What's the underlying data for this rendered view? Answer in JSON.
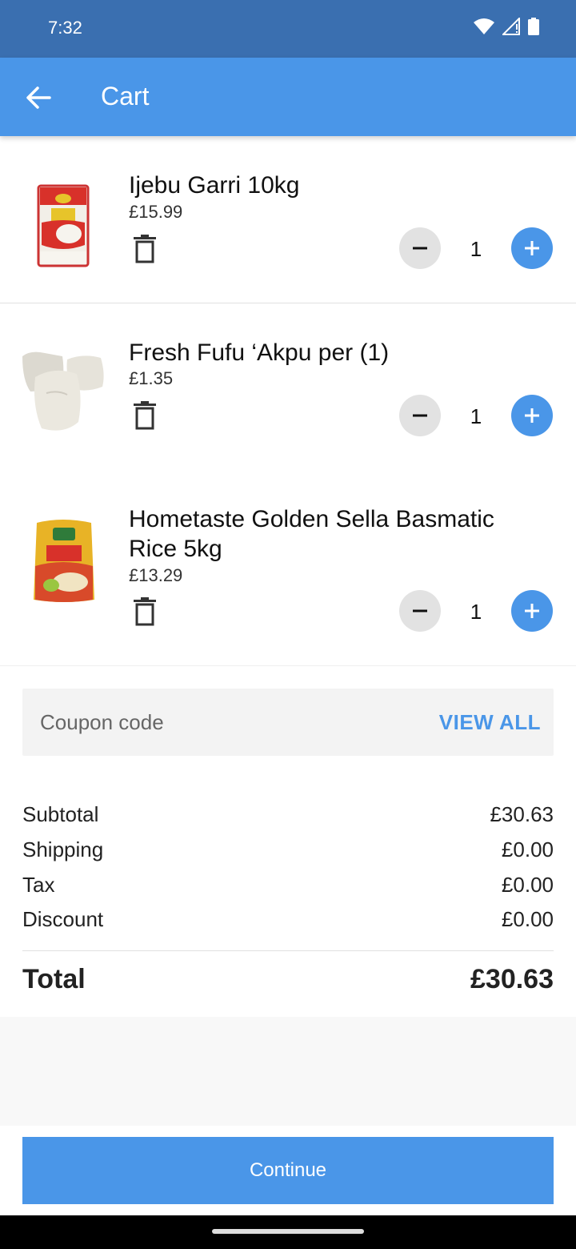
{
  "status": {
    "time": "7:32"
  },
  "header": {
    "title": "Cart"
  },
  "items": [
    {
      "name": "Ijebu Garri 10kg",
      "price": "£15.99",
      "qty": "1"
    },
    {
      "name": "Fresh Fufu ‘Akpu per (1)",
      "price": "£1.35",
      "qty": "1"
    },
    {
      "name": "Hometaste Golden Sella Basmatic Rice 5kg",
      "price": "£13.29",
      "qty": "1"
    }
  ],
  "coupon": {
    "placeholder": "Coupon code",
    "view_all_label": "VIEW ALL"
  },
  "summary": {
    "subtotal_label": "Subtotal",
    "subtotal_value": "£30.63",
    "shipping_label": "Shipping",
    "shipping_value": "£0.00",
    "tax_label": "Tax",
    "tax_value": "£0.00",
    "discount_label": "Discount",
    "discount_value": "£0.00",
    "total_label": "Total",
    "total_value": "£30.63"
  },
  "footer": {
    "continue_label": "Continue"
  },
  "colors": {
    "accent": "#4a96e8",
    "status_bar": "#3a6fb0"
  }
}
